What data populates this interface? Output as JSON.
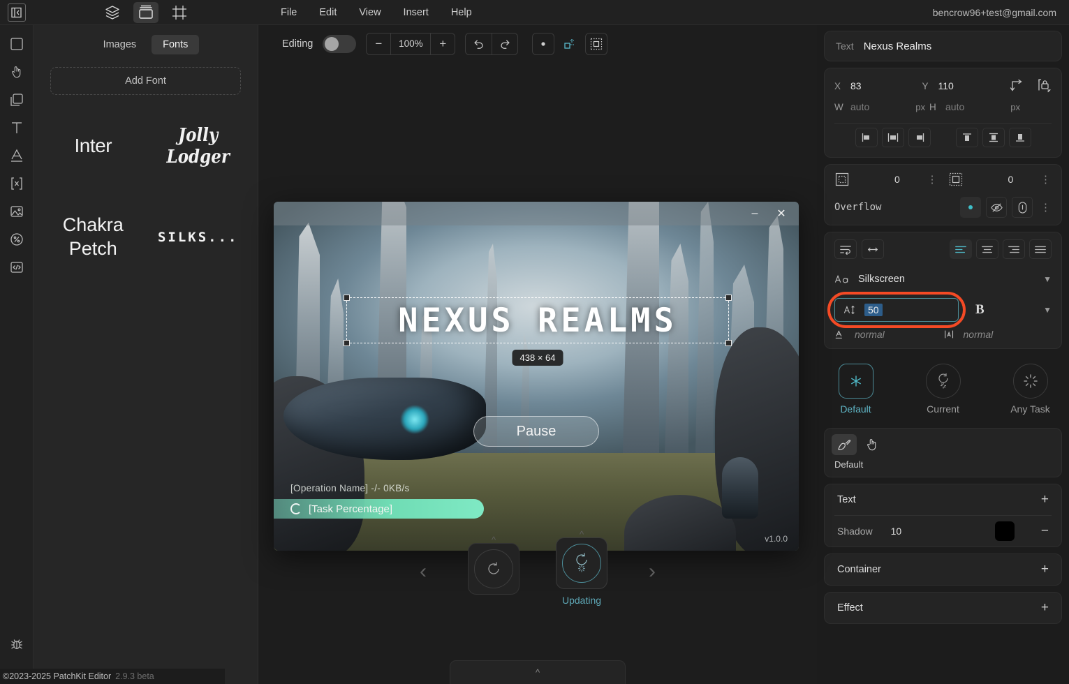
{
  "topbar": {
    "panel_toggle_icon": "collapse-panel-icon",
    "modes": [
      {
        "name": "layers",
        "icon": "layers-icon",
        "active": false
      },
      {
        "name": "assets",
        "icon": "archive-box-icon",
        "active": true
      },
      {
        "name": "frame",
        "icon": "frame-icon",
        "active": false
      }
    ],
    "menu": [
      "File",
      "Edit",
      "View",
      "Insert",
      "Help"
    ],
    "user_email": "bencrow96+test@gmail.com"
  },
  "rail": {
    "items": [
      {
        "name": "rectangle-tool",
        "icon": "square-icon"
      },
      {
        "name": "pointer-tool",
        "icon": "hand-pointer-icon"
      },
      {
        "name": "duplicate-tool",
        "icon": "copy-icon"
      },
      {
        "name": "text-tool",
        "icon": "text-t-icon"
      },
      {
        "name": "font-tool",
        "icon": "underlined-a-icon"
      },
      {
        "name": "variable-tool",
        "icon": "bracket-x-icon"
      },
      {
        "name": "image-tool",
        "icon": "image-icon"
      },
      {
        "name": "percent-tool",
        "icon": "percent-circle-icon"
      },
      {
        "name": "code-tool",
        "icon": "code-icon"
      }
    ],
    "bottom": {
      "name": "debug",
      "icon": "bug-icon"
    }
  },
  "assets": {
    "tabs": [
      {
        "label": "Images",
        "active": false
      },
      {
        "label": "Fonts",
        "active": true
      }
    ],
    "add_button": "Add Font",
    "fonts": [
      "Inter",
      "Jolly Lodger",
      "Chakra Petch",
      "SILKS..."
    ]
  },
  "canvas_toolbar": {
    "editing_label": "Editing",
    "editing_on": false,
    "zoom": {
      "minus": "−",
      "value": "100%",
      "plus": "+"
    },
    "history": [
      {
        "name": "undo-button",
        "icon": "undo-arrow-icon"
      },
      {
        "name": "redo-button",
        "icon": "redo-arrow-icon"
      }
    ],
    "snap": [
      {
        "name": "snap-point-button",
        "icon": "dot-icon"
      },
      {
        "name": "snap-object-button",
        "icon": "snap-object-icon"
      },
      {
        "name": "snap-grid-button",
        "icon": "grid-snap-icon"
      }
    ]
  },
  "launcher": {
    "window_buttons": {
      "minimize": "–",
      "close": "✕"
    },
    "title_text": "NEXUS REALMS",
    "size_badge": "438 × 64",
    "pause_button": "Pause",
    "operation_line": "[Operation Name]    -/-    0KB/s",
    "progress_text": "[Task Percentage]",
    "progress_percent": 40,
    "version": "v1.0.0",
    "progress_color": "#6fdcb4"
  },
  "carousel": {
    "prev_icon": "chevron-left-icon",
    "next_icon": "chevron-right-icon",
    "states": [
      {
        "label": "",
        "name": "state-restart",
        "active": false
      },
      {
        "label": "Updating",
        "name": "state-updating",
        "active": true
      }
    ],
    "bottom_sheet_icon": "chevron-up-icon",
    "accent_color": "#5fa9b8"
  },
  "inspector": {
    "object": {
      "type_label": "Text",
      "name": "Nexus Realms"
    },
    "geometry": {
      "x_label": "X",
      "x_value": "83",
      "y_label": "Y",
      "y_value": "110",
      "w_label": "W",
      "w_value": "auto",
      "w_unit": "px",
      "h_label": "H",
      "h_value": "auto",
      "h_unit": "px",
      "corner_icon": "corner-anchor-icon",
      "lock_icon": "aspect-lock-icon"
    },
    "align": {
      "horizontal": [
        "align-left-icon",
        "align-center-h-icon",
        "align-right-icon"
      ],
      "vertical": [
        "align-top-icon",
        "align-middle-v-icon",
        "align-bottom-icon"
      ]
    },
    "spacing": {
      "padding_icon": "padding-icon",
      "padding_value": "0",
      "margin_icon": "margin-icon",
      "margin_value": "0",
      "overflow_label": "Overflow",
      "overflow_options": [
        {
          "name": "overflow-visible",
          "icon": "dot-icon",
          "active": true
        },
        {
          "name": "overflow-hidden",
          "icon": "eye-slash-icon",
          "active": false
        },
        {
          "name": "overflow-scroll",
          "icon": "scroll-capsule-icon",
          "active": false
        }
      ]
    },
    "typography": {
      "wrap_icons": [
        "text-wrap-icon",
        "text-nowrap-icon"
      ],
      "align_icons": [
        "text-align-left-icon",
        "text-align-center-icon",
        "text-align-right-icon",
        "text-align-justify-icon"
      ],
      "align_active_index": 0,
      "font_icon": "font-aa-icon",
      "font_family": "Silkscreen",
      "size_icon": "font-size-icon",
      "size_value": "50",
      "bold_label": "B",
      "line_height_icon": "line-height-icon",
      "line_height_value": "normal",
      "letter_spacing_icon": "letter-spacing-icon",
      "letter_spacing_value": "normal",
      "highlight_color": "#f44a25"
    },
    "state_tabs": [
      {
        "label": "Default",
        "icon": "asterisk-icon",
        "active": true
      },
      {
        "label": "Current",
        "icon": "refresh-spinner-icon",
        "active": false
      },
      {
        "label": "Any Task",
        "icon": "spinner-dots-icon",
        "active": false
      }
    ],
    "style_tools": [
      {
        "name": "paint-tool",
        "icon": "paint-brush-icon",
        "active": true
      },
      {
        "name": "interaction-tool",
        "icon": "hand-pointer-icon",
        "active": false
      }
    ],
    "style_name": "Default",
    "sections": [
      {
        "title": "Text",
        "expanded": true,
        "rows": [
          {
            "key": "Shadow",
            "value": "10",
            "color": "#000000"
          }
        ]
      },
      {
        "title": "Container",
        "expanded": false,
        "rows": []
      },
      {
        "title": "Effect",
        "expanded": false,
        "rows": []
      }
    ]
  },
  "footer": {
    "copyright": "©2023-2025 PatchKit Editor",
    "version": "2.9.3 beta"
  }
}
